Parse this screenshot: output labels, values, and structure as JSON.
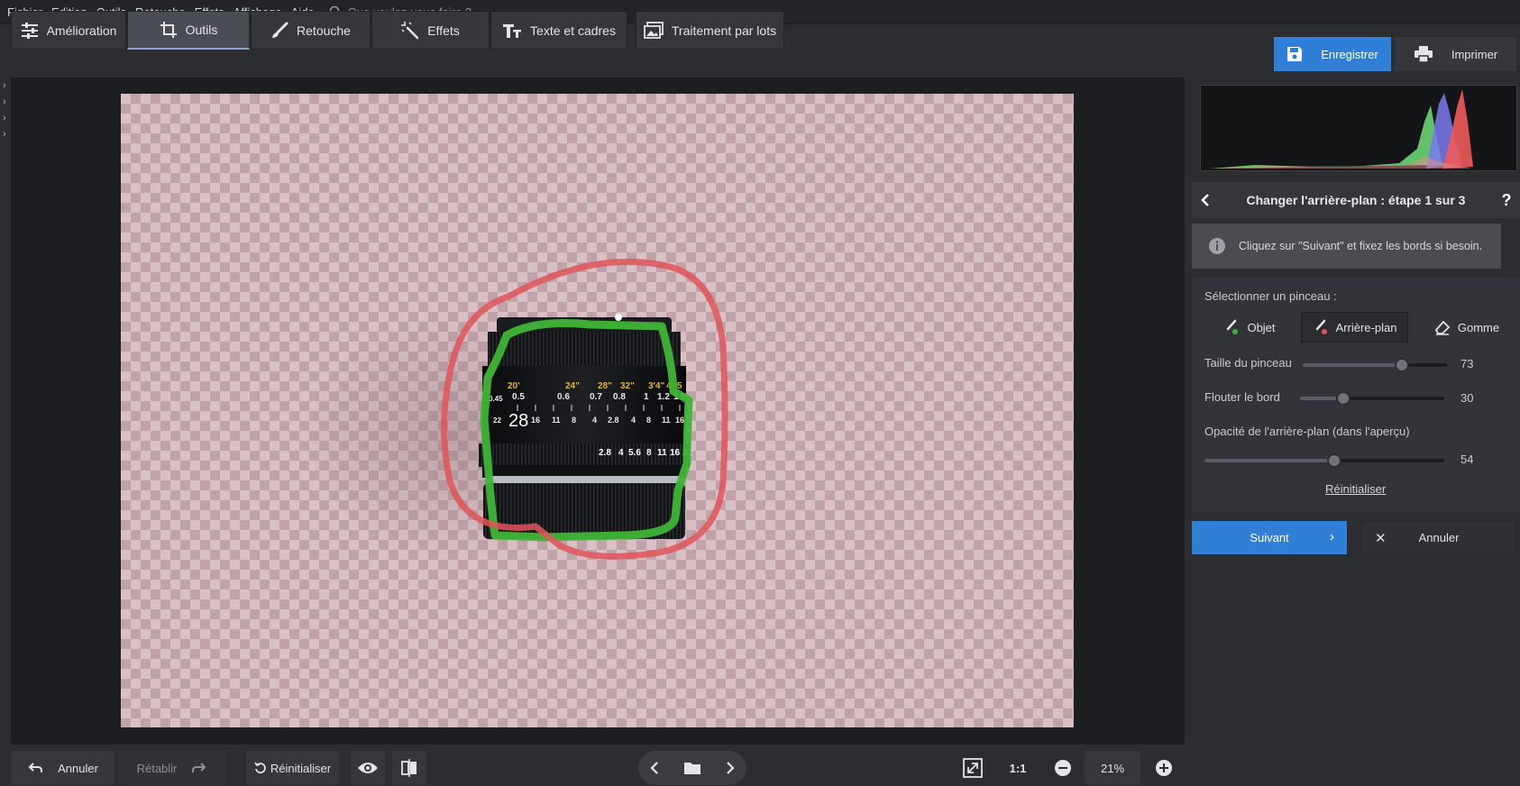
{
  "menu": {
    "items": [
      "Fichier",
      "Edition",
      "Outils",
      "Retouche",
      "Effets",
      "Affichage",
      "Aide"
    ],
    "search_placeholder": "Que voulez-vous faire ?"
  },
  "toolbar": {
    "tabs": [
      {
        "label": "Amélioration",
        "icon": "sliders-icon"
      },
      {
        "label": "Outils",
        "icon": "crop-icon",
        "active": true
      },
      {
        "label": "Retouche",
        "icon": "brush-icon"
      },
      {
        "label": "Effets",
        "icon": "magic-wand-icon"
      },
      {
        "label": "Texte et cadres",
        "icon": "text-icon"
      },
      {
        "label": "Traitement par lots",
        "icon": "batch-images-icon"
      }
    ],
    "save_label": "Enregistrer",
    "print_label": "Imprimer"
  },
  "panel": {
    "step_title": "Changer l'arrière-plan : étape 1 sur 3",
    "help": "?",
    "info_text": "Cliquez sur \"Suivant\" et fixez les bords si besoin.",
    "brush_label": "Sélectionner un pinceau :",
    "brushes": [
      {
        "label": "Objet",
        "icon": "object-brush-icon"
      },
      {
        "label": "Arrière-plan",
        "icon": "background-brush-icon",
        "active": true
      },
      {
        "label": "Gomme",
        "icon": "eraser-icon"
      }
    ],
    "sliders": [
      {
        "label": "Taille du pinceau",
        "value": 73,
        "fraction": 0.7
      },
      {
        "label": "Flouter le bord",
        "value": 30,
        "fraction": 0.3
      },
      {
        "label": "Opacité de l'arrière-plan (dans l'aperçu)",
        "value": 54,
        "fraction": 0.54
      }
    ],
    "reset_label": "Réinitialiser",
    "next_label": "Suivant",
    "cancel_label": "Annuler"
  },
  "bottom": {
    "undo_label": "Annuler",
    "redo_label": "Rétablir",
    "reset_label": "Réinitialiser",
    "one_to_one": "1:1",
    "zoom": "21%"
  },
  "lens": {
    "distance_ft": [
      "20'",
      "24\"",
      "28\"",
      "32\"",
      "3'4\"",
      "4",
      "5"
    ],
    "distance_m": [
      "0.5",
      "0.6",
      "0.7",
      "0.8",
      "1",
      "1.2",
      "1.5"
    ],
    "dof": [
      "22",
      "16",
      "11",
      "8",
      "4",
      "2.8",
      "4",
      "8",
      "11",
      "16"
    ],
    "focal_badge": "28",
    "left_small": "0.45",
    "apertures": [
      "2.8",
      "4",
      "5.6",
      "8",
      "11",
      "16",
      "22"
    ]
  },
  "colors": {
    "accent": "#2f7fd6",
    "object_stroke": "#3fb537",
    "background_stroke": "#e0555b"
  }
}
